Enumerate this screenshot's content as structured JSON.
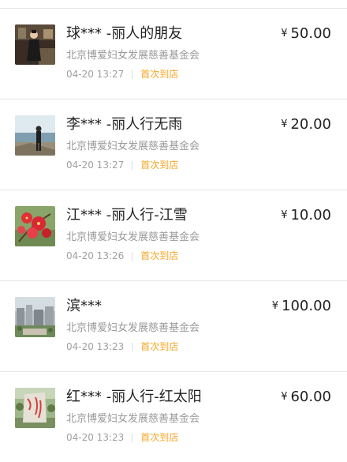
{
  "currency_symbol": "¥",
  "donations": [
    {
      "donor": "球*** -丽人的朋友",
      "organization": "北京博爱妇女发展慈善基金会",
      "time": "04-20 13:27",
      "badge": "首次到店",
      "amount": "50.00",
      "avatar_icon": "photo-woman-in-dress-icon"
    },
    {
      "donor": "李*** -丽人行无雨",
      "organization": "北京博爱妇女发展慈善基金会",
      "time": "04-20 13:27",
      "badge": "首次到店",
      "amount": "20.00",
      "avatar_icon": "photo-person-at-seaside-icon"
    },
    {
      "donor": "江*** -丽人行-江雪",
      "organization": "北京博爱妇女发展慈善基金会",
      "time": "04-20 13:26",
      "badge": "首次到店",
      "amount": "10.00",
      "avatar_icon": "photo-red-flowers-icon"
    },
    {
      "donor": "滨***",
      "organization": "北京博爱妇女发展慈善基金会",
      "time": "04-20 13:23",
      "badge": "首次到店",
      "amount": "100.00",
      "avatar_icon": "photo-city-buildings-icon"
    },
    {
      "donor": "红*** -丽人行-红太阳",
      "organization": "北京博爱妇女发展慈善基金会",
      "time": "04-20 13:23",
      "badge": "首次到店",
      "amount": "60.00",
      "avatar_icon": "photo-stone-monument-icon"
    }
  ],
  "colors": {
    "badge": "#f5a623",
    "name": "#222222",
    "secondary": "#9a9a9a",
    "divider": "#e6e6e6"
  }
}
